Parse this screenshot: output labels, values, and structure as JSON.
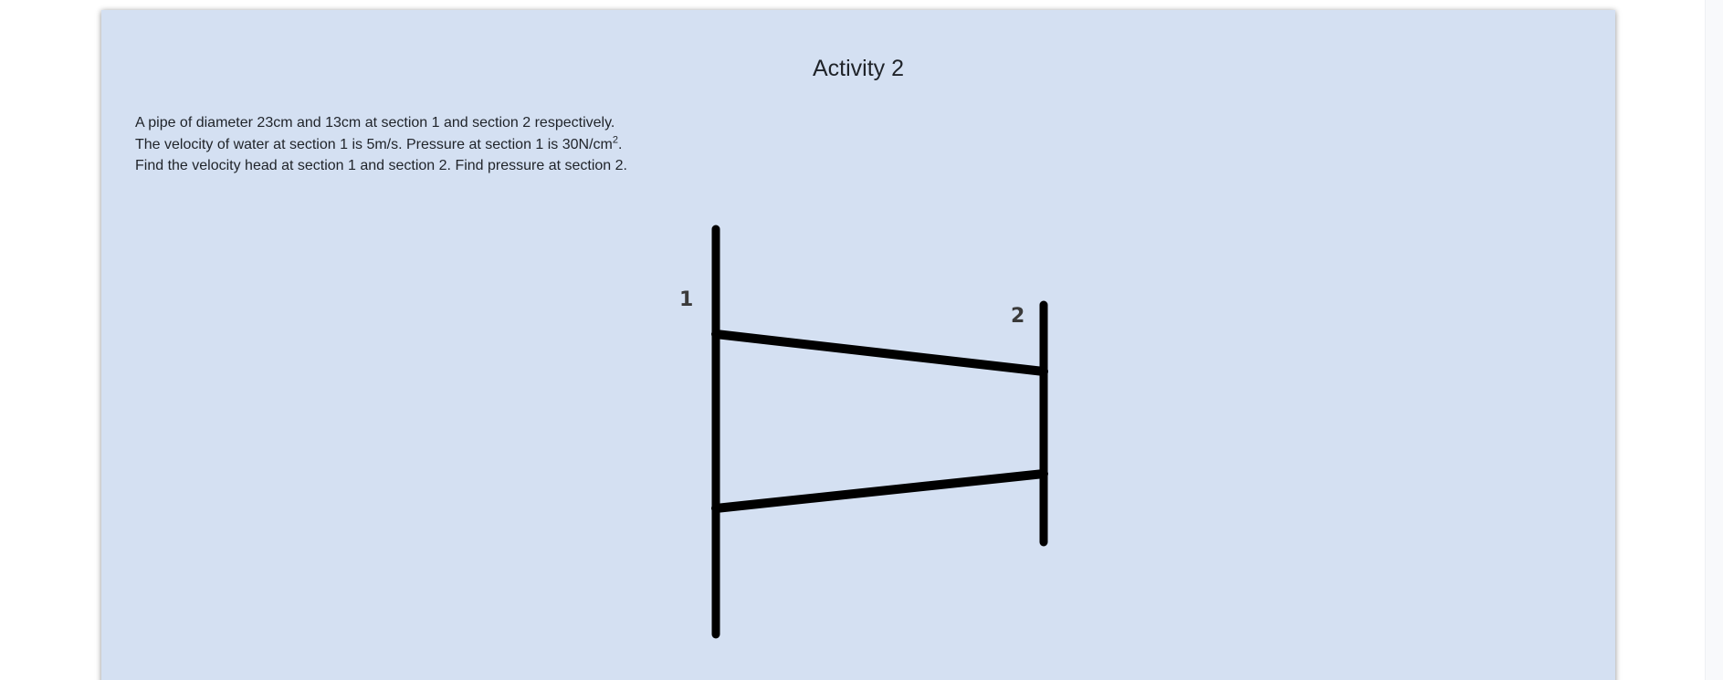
{
  "activity": {
    "title": "Activity 2",
    "problem_lines": [
      "A pipe of diameter 23cm and 13cm at section 1 and section 2 respectively.",
      "The velocity of water at section 1 is 5m/s. Pressure at section 1 is 30N/cm",
      "Find the velocity head at section 1 and section 2. Find pressure at section 2."
    ],
    "line2_superscript": "2",
    "line2_suffix": "."
  },
  "diagram": {
    "section1_label": "1",
    "section2_label": "2"
  }
}
